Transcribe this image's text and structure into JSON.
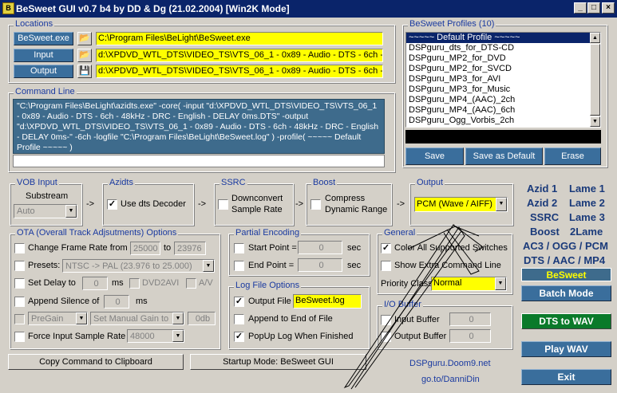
{
  "window": {
    "title": "BeSweet GUI v0.7 b4 by DD & Dg (21.02.2004)   [Win2K Mode]",
    "min": "_",
    "max": "□",
    "close": "×"
  },
  "locations": {
    "legend": "Locations",
    "besweet_label": "BeSweet.exe",
    "besweet_path": "C:\\Program Files\\BeLight\\BeSweet.exe",
    "input_label": "Input",
    "input_path": "d:\\XPDVD_WTL_DTS\\VIDEO_TS\\VTS_06_1 - 0x89 - Audio - DTS - 6ch -",
    "output_label": "Output",
    "output_path": "d:\\XPDVD_WTL_DTS\\VIDEO_TS\\VTS_06_1 - 0x89 - Audio - DTS - 6ch -"
  },
  "command_line": {
    "legend": "Command Line",
    "text": "\"C:\\Program Files\\BeLight\\azidts.exe\" -core( -input \"d:\\XPDVD_WTL_DTS\\VIDEO_TS\\VTS_06_1 - 0x89 - Audio - DTS - 6ch - 48kHz - DRC - English - DELAY 0ms.DTS\" -output \"d:\\XPDVD_WTL_DTS\\VIDEO_TS\\VTS_06_1 - 0x89 - Audio - DTS - 6ch - 48kHz - DRC - English - DELAY 0ms-\" -6ch -logfile \"C:\\Program Files\\BeLight\\BeSweet.log\" ) -profile( ~~~~~ Default Profile ~~~~~ )"
  },
  "profiles": {
    "legend": "BeSweet Profiles (10)",
    "items": [
      "~~~~~ Default Profile ~~~~~",
      "DSPguru_dts_for_DTS-CD",
      "DSPguru_MP2_for_DVD",
      "DSPguru_MP2_for_SVCD",
      "DSPguru_MP3_for_AVI",
      "DSPguru_MP3_for_Music",
      "DSPguru_MP4_(AAC)_2ch",
      "DSPguru_MP4_(AAC)_6ch",
      "DSPguru_Ogg_Vorbis_2ch"
    ],
    "save": "Save",
    "save_default": "Save as Default",
    "erase": "Erase"
  },
  "vob": {
    "legend": "VOB Input",
    "substream_label": "Substream",
    "substream_value": "Auto"
  },
  "azidts": {
    "legend": "Azidts",
    "use_dts": "Use dts Decoder"
  },
  "ssrc": {
    "legend": "SSRC",
    "downconvert": "Downconvert",
    "sample_rate": "Sample Rate"
  },
  "boost": {
    "legend": "Boost",
    "compress": "Compress",
    "dynamic": "Dynamic Range"
  },
  "output": {
    "legend": "Output",
    "format": "PCM (Wave / AIFF)"
  },
  "arrows": [
    "->",
    "->",
    "->",
    "->"
  ],
  "encoders": {
    "rows": [
      [
        "Azid 1",
        "Lame 1"
      ],
      [
        "Azid 2",
        "Lame 2"
      ],
      [
        "SSRC",
        "Lame 3"
      ],
      [
        "Boost",
        "2Lame"
      ]
    ],
    "line5": "AC3 / OGG / PCM",
    "line6": "DTS / AAC / MP4",
    "brand": "BeSweet"
  },
  "ota": {
    "legend": "OTA (Overall Track Adjsutments) Options",
    "change_frame_rate": "Change Frame Rate from",
    "fr_from": "25000",
    "to": "to",
    "fr_to": "23976",
    "presets": "Presets:",
    "preset_value": "NTSC -> PAL   (23.976 to 25.000)",
    "set_delay": "Set Delay to",
    "delay_value": "0",
    "ms": "ms",
    "dvd2avi": "DVD2AVI",
    "av": "A/V",
    "append_silence": "Append Silence of",
    "silence_value": "0",
    "ms2": "ms",
    "pregain": "PreGain",
    "manual_gain": "Set Manual Gain to",
    "gain_value": "0db",
    "force_rate": "Force Input Sample Rate",
    "rate_value": "48000"
  },
  "partial": {
    "legend": "Partial Encoding",
    "start": "Start Point =",
    "start_value": "0",
    "end": "End Point =",
    "end_value": "0",
    "sec": "sec",
    "sec2": "sec"
  },
  "log": {
    "legend": "Log File Options",
    "output_file": "Output File",
    "file_name": "BeSweet.log",
    "append": "Append to End of File",
    "popup": "PopUp Log When Finished"
  },
  "general": {
    "legend": "General",
    "color_switches": "Color All Supported Switches",
    "show_cmd": "Show Extra Command Line",
    "priority": "Priority Class",
    "priority_value": "Normal"
  },
  "io": {
    "legend": "I/O Buffer",
    "input_buffer": "Input Buffer",
    "input_value": "0",
    "output_buffer": "Output Buffer",
    "output_value": "0"
  },
  "buttons": {
    "copy": "Copy Command to Clipboard",
    "startup": "Startup Mode: BeSweet GUI",
    "batch": "Batch Mode",
    "dts_wav": "DTS to WAV",
    "play_wav": "Play WAV",
    "exit": "Exit"
  },
  "links": {
    "doom9": "DSPguru.Doom9.net",
    "danni": "go.to/DanniDin"
  },
  "checked": {
    "use_dts": true,
    "output_file": true,
    "popup": true,
    "color_switches": true
  }
}
